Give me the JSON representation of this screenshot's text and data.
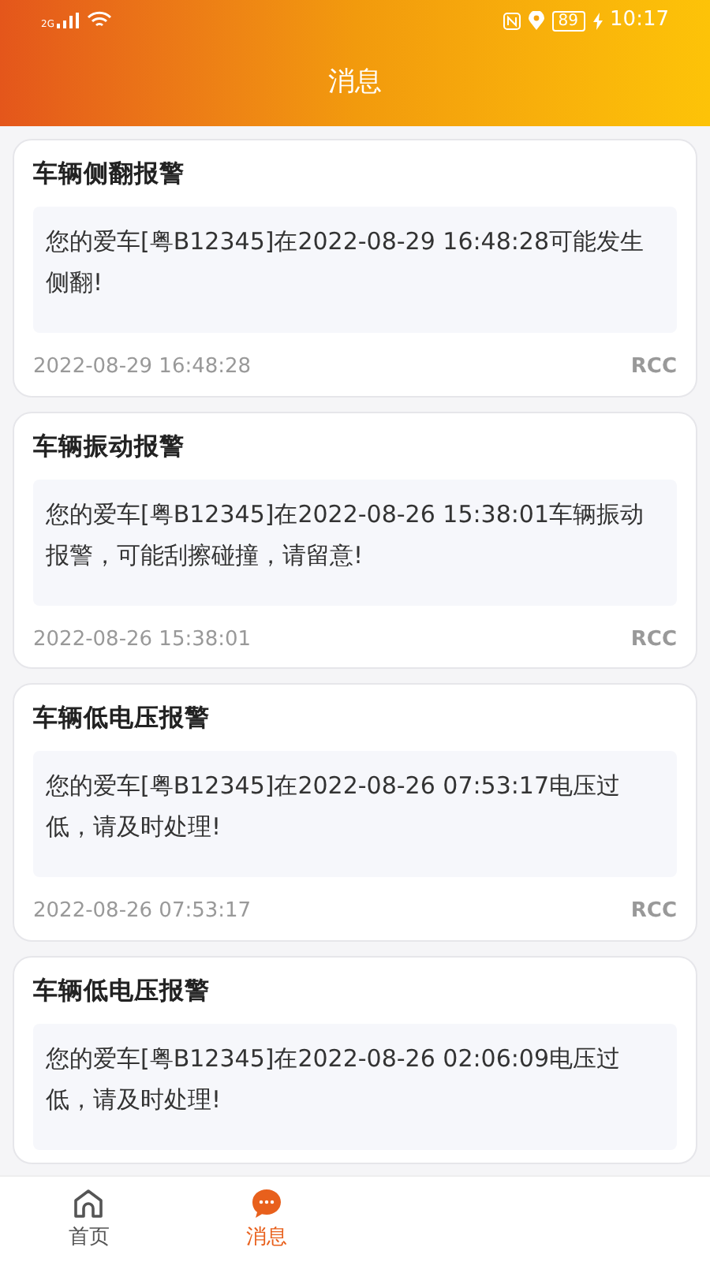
{
  "status_bar": {
    "network": "2G",
    "battery": "89",
    "time": "10:17"
  },
  "header": {
    "title": "消息"
  },
  "messages": [
    {
      "title": "车辆侧翻报警",
      "body": "您的爱车[粤B12345]在2022-08-29 16:48:28可能发生侧翻!",
      "time": "2022-08-29 16:48:28",
      "source": "RCC"
    },
    {
      "title": "车辆振动报警",
      "body": "您的爱车[粤B12345]在2022-08-26 15:38:01车辆振动报警，可能刮擦碰撞，请留意!",
      "time": "2022-08-26 15:38:01",
      "source": "RCC"
    },
    {
      "title": "车辆低电压报警",
      "body": "您的爱车[粤B12345]在2022-08-26 07:53:17电压过低，请及时处理!",
      "time": "2022-08-26 07:53:17",
      "source": "RCC"
    },
    {
      "title": "车辆低电压报警",
      "body": "您的爱车[粤B12345]在2022-08-26 02:06:09电压过低，请及时处理!"
    }
  ],
  "nav": [
    {
      "kind": "home",
      "label": "首页",
      "selected": false
    },
    {
      "kind": "messages",
      "label": "消息",
      "selected": true
    }
  ]
}
